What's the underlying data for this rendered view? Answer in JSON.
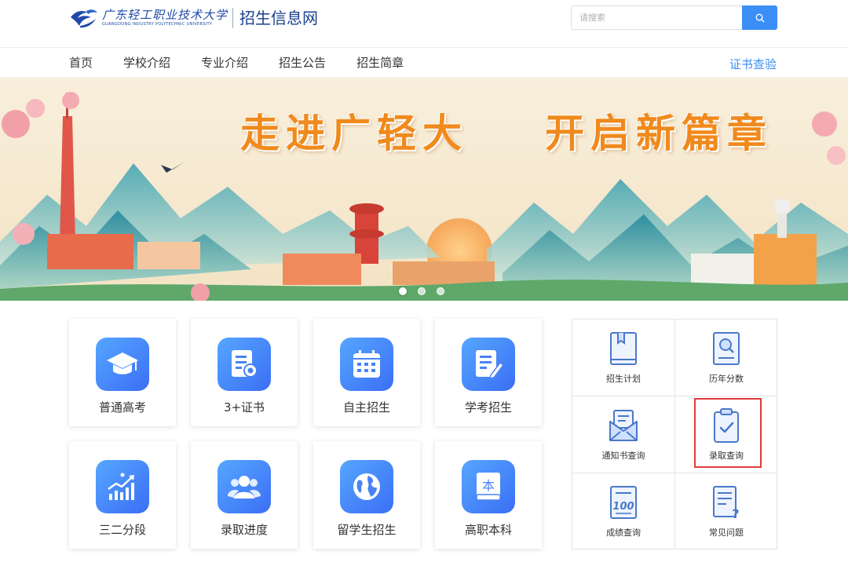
{
  "header": {
    "logo_cn": "广东轻工职业技术大学",
    "logo_en": "GUANGDONG INDUSTRY POLYTECHNIC UNIVERSITY",
    "site_title": "招生信息网",
    "search_placeholder": "请搜索",
    "search_icon": "search-icon"
  },
  "nav": {
    "items": [
      "首页",
      "学校介绍",
      "专业介绍",
      "招生公告",
      "招生简章"
    ],
    "right_link": "证书查验"
  },
  "banner": {
    "slogan_a": "走进广轻大",
    "slogan_b": "开启新篇章",
    "dots": 3,
    "active_dot": 1
  },
  "tiles": [
    {
      "label": "普通高考",
      "icon": "graduation-cap-icon"
    },
    {
      "label": "3+证书",
      "icon": "certificate-document-icon"
    },
    {
      "label": "自主招生",
      "icon": "calendar-icon"
    },
    {
      "label": "学考招生",
      "icon": "edit-document-icon"
    },
    {
      "label": "三二分段",
      "icon": "growth-chart-icon"
    },
    {
      "label": "录取进度",
      "icon": "users-icon"
    },
    {
      "label": "留学生招生",
      "icon": "globe-icon"
    },
    {
      "label": "高职本科",
      "icon": "book-icon"
    }
  ],
  "quick_links": [
    {
      "label": "招生计划",
      "icon": "book-plan-icon"
    },
    {
      "label": "历年分数",
      "icon": "search-document-icon"
    },
    {
      "label": "通知书查询",
      "icon": "envelope-icon"
    },
    {
      "label": "录取查询",
      "icon": "clipboard-check-icon",
      "highlighted": true
    },
    {
      "label": "成绩查询",
      "icon": "score-sheet-icon"
    },
    {
      "label": "常见问题",
      "icon": "question-document-icon"
    }
  ],
  "colors": {
    "accent": "#3a8ef6",
    "tile_gradient_start": "#56a6ff",
    "tile_gradient_end": "#3b6ef5",
    "slogan": "#f08a1c",
    "highlight_border": "#e23a3a",
    "icon_line": "#4a78c8"
  }
}
